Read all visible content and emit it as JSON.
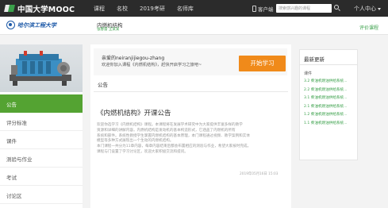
{
  "topnav": {
    "logo_text": "中国大学MOOC",
    "items": [
      "课程",
      "名校",
      "2019考研",
      "名师库"
    ],
    "app_label": "客户端",
    "search_placeholder": "搜索感兴趣的课程",
    "personal_center": "个人中心"
  },
  "course": {
    "school_name": "哈尔滨工程大学",
    "title": "内燃机结构",
    "teachers": "张春雷  王某某",
    "rate_label": "评价课程"
  },
  "sidebar": {
    "menu": [
      {
        "label": "公告",
        "active": true
      },
      {
        "label": "评分标准",
        "active": false
      },
      {
        "label": "课件",
        "active": false
      },
      {
        "label": "测验与作业",
        "active": false
      },
      {
        "label": "考试",
        "active": false
      },
      {
        "label": "讨论区",
        "active": false
      }
    ]
  },
  "welcome": {
    "greeting": "亲爱的neiranjijiegou-zhang",
    "message": "欢迎你加入课程《内燃机结构》，赶快开启学习之旅吧~",
    "button": "开始学习"
  },
  "announcement": {
    "section_title": "公告",
    "title": "《内燃机结构》开课公告",
    "body": [
      "欢迎你选学习《内燃机结构》课程。本课程将在发展学术研究中为大家提供丰富多样的教学",
      "资源和详细的讲解内容。内燃机结构是发动机的基本构造形式，它涵盖了内燃机的所有",
      "系统和部件。系统性教授学生掌握内燃机结构的基本原理，本门课程通过视频、教学案例和实体",
      "模型等多种方式展现出一个生动的内燃机结构。",
      "本门课程一共分为11章内容，每章内容结束后都会布置相应的测验与作业，希望大家按时完成。",
      "课程与门设置了学习讨论区，欢迎大家积极交流和提问。"
    ],
    "date": "2019年05月16日 15:03"
  },
  "updates": {
    "header": "最新更新",
    "category": "课件",
    "items": [
      "3.2 柴油机燃油供给系统...",
      "2.2 柴油机燃油供给系统...",
      "3.1 柴油机燃油供给系统...",
      "2.1 柴油机燃油供给系统...",
      "1.2 柴油机燃油供给系统...",
      "1.1 柴油机燃油供给系统..."
    ]
  },
  "colors": {
    "nav_bg": "#2b2b2b",
    "brand_green": "#54a332",
    "link_green": "#3aa04a",
    "button_orange": "#f08a1a",
    "school_blue": "#1e5aa8"
  }
}
